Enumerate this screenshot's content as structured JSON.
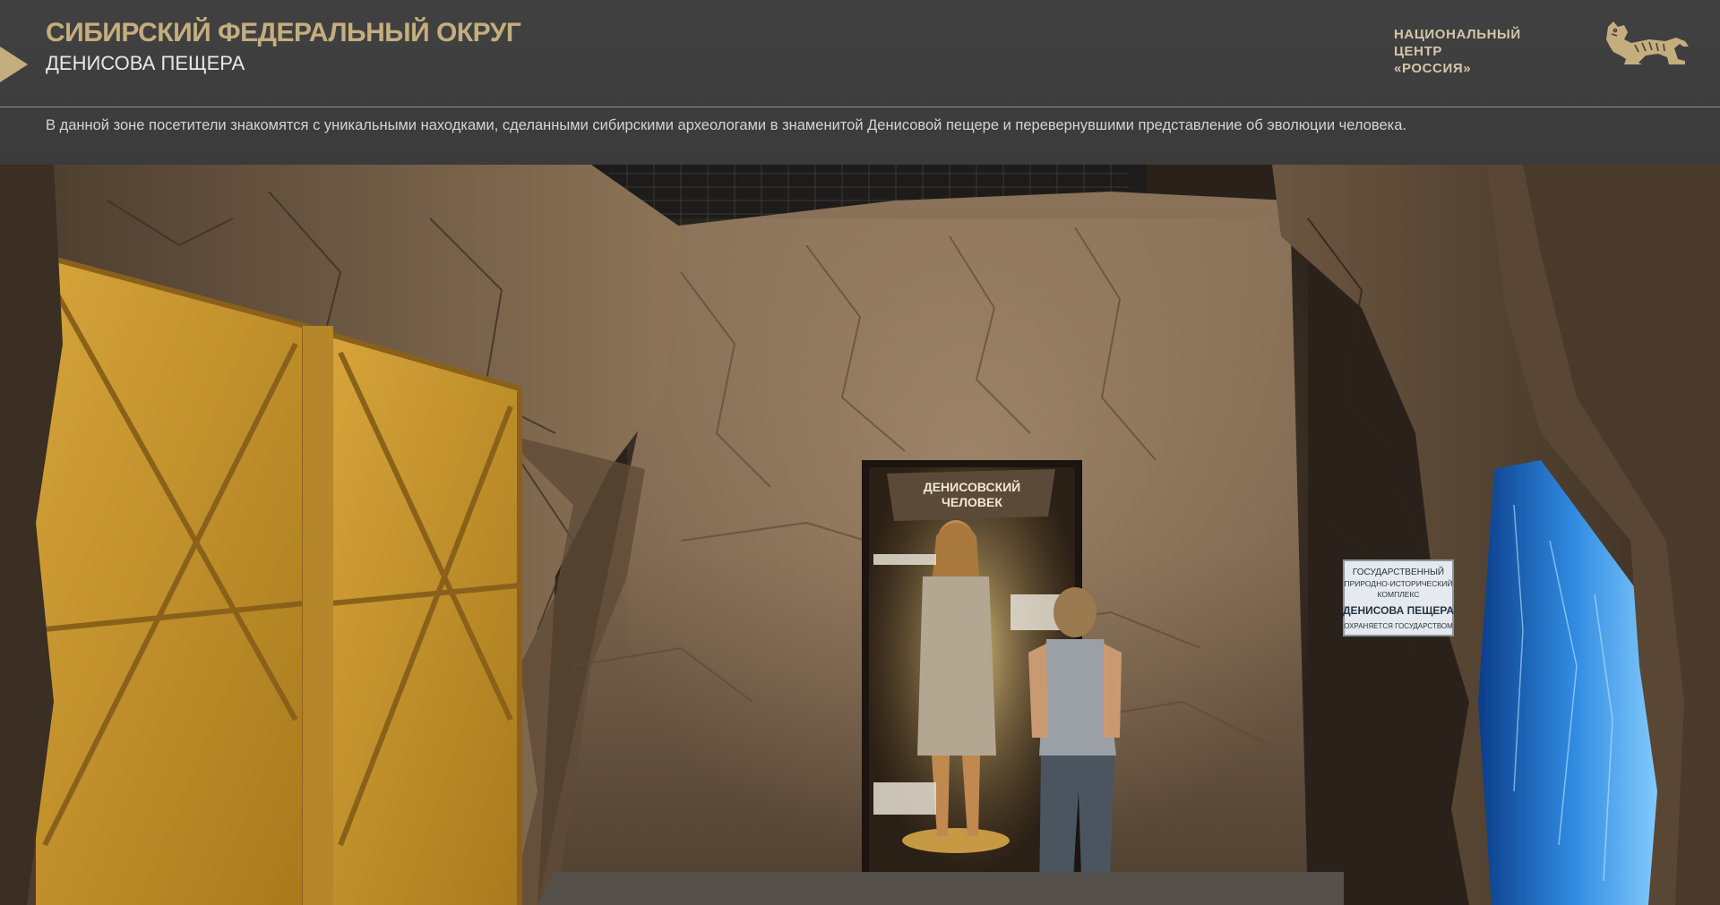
{
  "header": {
    "region": "СИБИРСКИЙ ФЕДЕРАЛЬНЫЙ ОКРУГ",
    "zone": "ДЕНИСОВА ПЕЩЕРА",
    "org_line1": "НАЦИОНАЛЬНЫЙ ЦЕНТР",
    "org_line2": "«РОССИЯ»",
    "logo_icon": "tiger-logo-icon"
  },
  "description": "В данной зоне посетители знакомятся с уникальными находками, сделанными сибирскими археологами в знаменитой Денисовой пещере и перевернувшими представление об эволюции человека.",
  "scene": {
    "exhibit_title_line1": "ДЕНИСОВСКИЙ",
    "exhibit_title_line2": "ЧЕЛОВЕК",
    "sign_line1": "ГОСУДАРСТВЕННЫЙ",
    "sign_line2": "ПРИРОДНО-ИСТОРИЧЕСКИЙ",
    "sign_line3": "КОМПЛЕКС",
    "sign_line4": "ДЕНИСОВА ПЕЩЕРА",
    "sign_line5": "ОХРАНЯЕТСЯ ГОСУДАРСТВОМ"
  },
  "colors": {
    "accent_gold": "#c5ae7e",
    "header_bg": "#3e3e3e",
    "door_gold": "#c9962a"
  }
}
